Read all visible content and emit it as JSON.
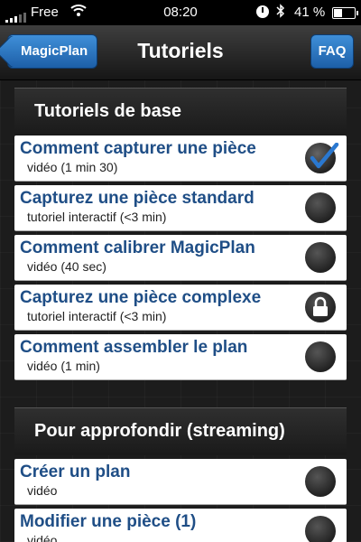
{
  "status_bar": {
    "carrier": "Free",
    "time": "08:20",
    "battery": "41 %",
    "icons": [
      "signal-icon",
      "wifi-icon",
      "alarm-clock-icon",
      "bluetooth-icon",
      "battery-icon"
    ]
  },
  "navbar": {
    "back_label": "MagicPlan",
    "title": "Tutoriels",
    "faq_label": "FAQ"
  },
  "colors": {
    "nav_button": "#2a74c2",
    "item_title": "#1f4e86",
    "status_dot": "#2d2d2d",
    "check": "#2a78d0"
  },
  "sections": [
    {
      "header": "Tutoriels de base",
      "items": [
        {
          "title": "Comment capturer une pièce",
          "subtitle": "vidéo (1 min 30)",
          "state": "done"
        },
        {
          "title": "Capturez une pièce standard",
          "subtitle": "tutoriel interactif (<3 min)",
          "state": "todo"
        },
        {
          "title": "Comment calibrer MagicPlan",
          "subtitle": "vidéo (40 sec)",
          "state": "todo"
        },
        {
          "title": "Capturez une pièce complexe",
          "subtitle": "tutoriel interactif (<3 min)",
          "state": "locked"
        },
        {
          "title": "Comment assembler le plan",
          "subtitle": "vidéo (1 min)",
          "state": "todo"
        }
      ]
    },
    {
      "header": "Pour approfondir (streaming)",
      "items": [
        {
          "title": "Créer un plan",
          "subtitle": "vidéo",
          "state": "todo"
        },
        {
          "title": "Modifier une pièce (1)",
          "subtitle": "vidéo",
          "state": "todo"
        }
      ]
    }
  ]
}
